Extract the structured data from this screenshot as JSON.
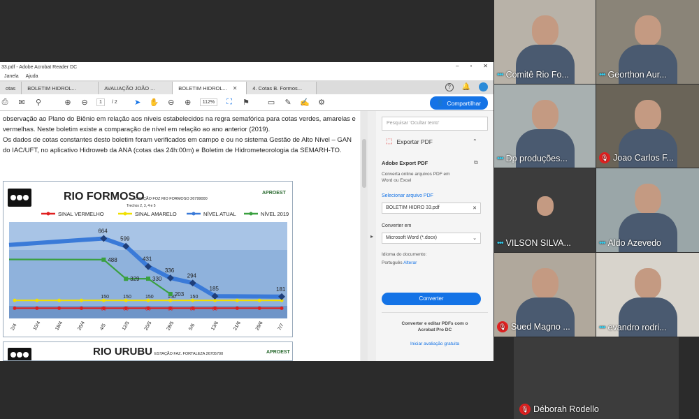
{
  "acrobat": {
    "title": "33.pdf - Adobe Acrobat Reader DC",
    "menu": [
      "Janela",
      "Ajuda"
    ],
    "tabs": [
      {
        "label": "otas",
        "active": false
      },
      {
        "label": "BOLETIM HIDROL...",
        "active": false
      },
      {
        "label": "AVALIAÇÃO JOÃO ...",
        "active": false
      },
      {
        "label": "BOLETIM HIDROL...",
        "active": true
      },
      {
        "label": "4. Cotas B. Formos...",
        "active": false
      }
    ],
    "page_current": "1",
    "page_total": "/ 2",
    "zoom": "112%",
    "share_label": "Compartilhar",
    "doc_text": "observação ao Plano do Biênio em relação aos níveis estabelecidos na regra semafórica para cotas verdes, amarelas e vermelhas. Neste boletim existe a comparação de nível em relação ao ano anterior (2019).",
    "doc_text2": "Os dados de cotas constantes desto boletim foram verificados em campo e ou no sistema Gestão de Alto Nível – GAN do IAC/UFT, no aplicativo Hidroweb da ANA (cotas das 24h:00m) e Boletim de Hidrometeorologia da SEMARH-TO.",
    "panel": {
      "search_placeholder": "Pesquisar 'Ocultar texto'",
      "export_title": "Exportar PDF",
      "adobe_export": "Adobe Export PDF",
      "desc": "Converta online arquivos PDF em Word ou Excel",
      "select_file": "Selecionar arquivo PDF",
      "file": "BOLETIM HIDRO 33.pdf",
      "convert_to": "Converter em",
      "format": "Microsoft Word (*.docx)",
      "lang_label": "Idioma do documento:",
      "lang": "Português",
      "lang_change": "Alterar",
      "convert_btn": "Converter",
      "promo": "Converter e editar PDFs com o Acrobat Pro DC",
      "trial": "Iniciar avaliação gratuita"
    }
  },
  "chart_data": {
    "type": "line",
    "title": "RIO FORMOSO",
    "subtitle": "ESTAÇÃO FOZ RIO FORMOSO 26799000",
    "subtitle2": "Trechos 2, 3, 4 e 5",
    "logo": "APROEST",
    "categories": [
      "2/4",
      "10/4",
      "18/4",
      "26/4",
      "4/5",
      "12/5",
      "20/5",
      "28/5",
      "5/6",
      "13/6",
      "21/6",
      "29/6",
      "7/7"
    ],
    "series": [
      {
        "name": "SINAL VERMELHO",
        "color": "#e02020",
        "values": [
          85,
          85,
          85,
          85,
          85,
          85,
          85,
          85,
          85,
          85,
          85,
          85,
          85
        ]
      },
      {
        "name": "SINAL AMARELO",
        "color": "#f0e000",
        "values": [
          150,
          150,
          150,
          150,
          150,
          150,
          150,
          150,
          150,
          150,
          150,
          150,
          150
        ]
      },
      {
        "name": "NÍVEL ATUAL",
        "color": "#3a7ad8",
        "values": [
          null,
          null,
          null,
          null,
          664,
          599,
          431,
          336,
          294,
          185,
          null,
          null,
          181
        ]
      },
      {
        "name": "NÍVEL 2019",
        "color": "#3aa040",
        "values": [
          null,
          null,
          null,
          null,
          488,
          329,
          330,
          203,
          null,
          null,
          null,
          null,
          null
        ]
      }
    ],
    "labels_visible": [
      "664",
      "599",
      "431",
      "336",
      "294",
      "185",
      "181",
      "488",
      "329",
      "330",
      "203",
      "150",
      "150",
      "150",
      "150",
      "85",
      "85",
      "85",
      "85",
      "85",
      "85",
      "85"
    ],
    "ylim": [
      0,
      800
    ],
    "second_title": "RIO URUBU",
    "second_subtitle": "ESTAÇÃO FAZ. FORTALEZA 26705700"
  },
  "participants": [
    {
      "name": "Comitê Rio Fo...",
      "muted": false,
      "bg": "#b8b2a8"
    },
    {
      "name": "Georthon Aur...",
      "muted": false,
      "bg": "#8a8478"
    },
    {
      "name": "Dp produções...",
      "muted": false,
      "bg": "#a8b0b0"
    },
    {
      "name": "Joao Carlos F...",
      "muted": true,
      "bg": "#6a6458"
    },
    {
      "name": "VILSON SILVA...",
      "muted": false,
      "bg": "#3c3c3c"
    },
    {
      "name": "Aldo Azevedo",
      "muted": false,
      "bg": "#9aa6a8"
    },
    {
      "name": "Sued Magno ...",
      "muted": true,
      "bg": "#b0a89c"
    },
    {
      "name": "evandro rodri...",
      "muted": false,
      "bg": "#d8d4cc"
    },
    {
      "name": "Déborah Rodello",
      "muted": true,
      "bg": "#3c3c3c"
    }
  ]
}
